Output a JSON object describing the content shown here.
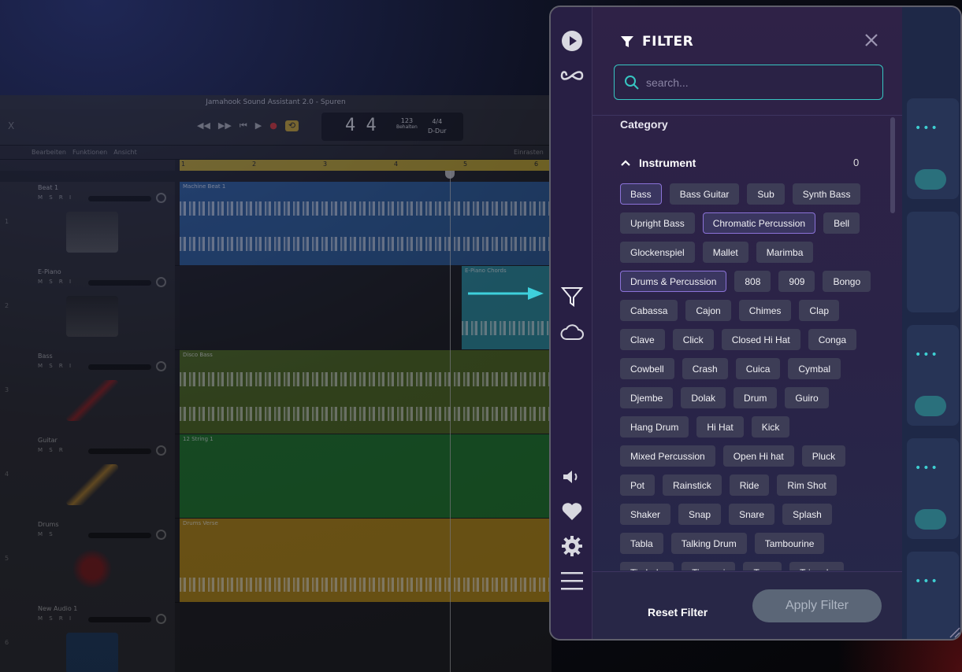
{
  "daw": {
    "title": "Jamahook Sound Assistant 2.0 - Spuren",
    "close": "X",
    "transport": {
      "bar": "4",
      "beat": "4",
      "tempo": "123",
      "tempo_label": "Behalten",
      "signature": "4/4",
      "key": "D-Dur"
    },
    "menu": [
      "Bearbeiten",
      "Funktionen",
      "Ansicht"
    ],
    "snap_label": "Einrasten",
    "ruler": [
      "1",
      "2",
      "3",
      "4",
      "5",
      "6"
    ],
    "tracks": [
      {
        "num": "1",
        "name": "Beat 1",
        "msr": "M S R I",
        "region": "Machine Beat 1"
      },
      {
        "num": "2",
        "name": "E-Piano",
        "msr": "M S R I",
        "region": "E-Piano Chords"
      },
      {
        "num": "3",
        "name": "Bass",
        "msr": "M S R I",
        "region": "Disco Bass"
      },
      {
        "num": "4",
        "name": "Guitar",
        "msr": "M S R",
        "region": "12 String 1"
      },
      {
        "num": "5",
        "name": "Drums",
        "msr": "M S",
        "region": "Drums Verse"
      },
      {
        "num": "6",
        "name": "New Audio 1",
        "msr": "M S R I",
        "region": ""
      }
    ]
  },
  "filter": {
    "title": "FILTER",
    "search_placeholder": "search...",
    "category_label": "Category",
    "section_label": "Instrument",
    "section_count": "0",
    "tag_rows": [
      [
        "Bass",
        "Bass Guitar",
        "Sub",
        "Synth Bass"
      ],
      [
        "Upright Bass",
        "Chromatic Percussion",
        "Bell"
      ],
      [
        "Glockenspiel",
        "Mallet",
        "Marimba"
      ],
      [
        "Drums & Percussion",
        "808",
        "909",
        "Bongo"
      ],
      [
        "Cabassa",
        "Cajon",
        "Chimes",
        "Clap"
      ],
      [
        "Clave",
        "Click",
        "Closed Hi Hat",
        "Conga"
      ],
      [
        "Cowbell",
        "Crash",
        "Cuica",
        "Cymbal"
      ],
      [
        "Djembe",
        "Dolak",
        "Drum",
        "Guiro"
      ],
      [
        "Hang Drum",
        "Hi Hat",
        "Kick"
      ],
      [
        "Mixed Percussion",
        "Open Hi hat",
        "Pluck"
      ],
      [
        "Pot",
        "Rainstick",
        "Ride",
        "Rim Shot"
      ],
      [
        "Shaker",
        "Snap",
        "Snare",
        "Splash"
      ],
      [
        "Tabla",
        "Talking Drum",
        "Tambourine"
      ],
      [
        "Timbale",
        "Timpani",
        "Tom",
        "Triangle"
      ]
    ],
    "selected": [
      "Bass",
      "Chromatic Percussion",
      "Drums & Percussion"
    ],
    "reset_label": "Reset Filter",
    "apply_label": "Apply Filter"
  },
  "colors": {
    "accent": "#37c6c2",
    "selected_border": "#8b72d8",
    "tag_bg": "#3d3d56",
    "arrow": "#3ed0dc"
  }
}
